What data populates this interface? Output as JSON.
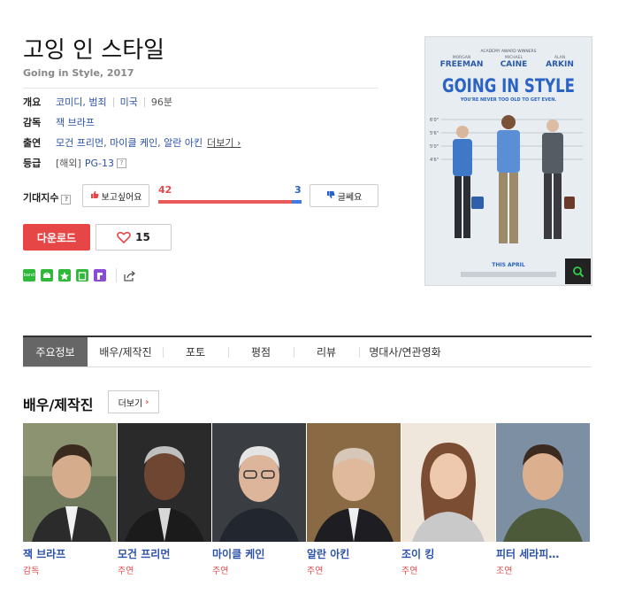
{
  "movie": {
    "title": "고잉 인 스타일",
    "subtitle": "Going in Style, 2017"
  },
  "info": {
    "overview_label": "개요",
    "genre": "코미디, 범죄",
    "country": "미국",
    "runtime": "96분",
    "director_label": "감독",
    "director": "잭 브라프",
    "cast_label": "출연",
    "cast": "모건 프리먼, 마이클 케인, 알란 아킨",
    "cast_more": "더보기 ›",
    "rating_label": "등급",
    "rating_region": "[해외]",
    "rating": "PG-13",
    "help_icon_text": "?"
  },
  "expectation": {
    "label": "기대지수",
    "want_label": "보고싶어요",
    "want_count": "42",
    "meh_label": "글쎄요",
    "meh_count": "3",
    "want_ratio": 0.933
  },
  "actions": {
    "download_label": "다운로드",
    "like_count": "15"
  },
  "share": {
    "icons": [
      "band-icon",
      "kakaostory-icon",
      "bookmark-star-icon",
      "note-icon",
      "flipboard-icon",
      "share-icon"
    ],
    "band_text": "band",
    "colors": {
      "green": "#2fb83a",
      "purple": "#8a4bd6"
    }
  },
  "poster": {
    "award_line": "ACADEMY AWARD WINNERS",
    "actor1_first": "MORGAN",
    "actor1_last": "FREEMAN",
    "actor2_first": "MICHAEL",
    "actor2_last": "CAINE",
    "actor3_first": "ALAN",
    "actor3_last": "ARKIN",
    "title": "GOING IN STYLE",
    "tagline": "YOU'RE NEVER TOO OLD TO GET EVEN.",
    "release": "THIS APRIL",
    "heights": [
      "6'0\"",
      "5'6\"",
      "5'0\"",
      "4'6\""
    ]
  },
  "tabs": [
    {
      "label": "주요정보",
      "active": true
    },
    {
      "label": "배우/제작진",
      "active": false
    },
    {
      "label": "포토",
      "active": false
    },
    {
      "label": "평점",
      "active": false
    },
    {
      "label": "리뷰",
      "active": false
    },
    {
      "label": "명대사/연관영화",
      "active": false
    }
  ],
  "cast_section": {
    "heading": "배우/제작진",
    "more_label": "더보기",
    "more_chevron": "›",
    "people": [
      {
        "name": "잭 브라프",
        "role": "감독"
      },
      {
        "name": "모건 프리먼",
        "role": "주연"
      },
      {
        "name": "마이클 케인",
        "role": "주연"
      },
      {
        "name": "알란 아킨",
        "role": "주연"
      },
      {
        "name": "조이 킹",
        "role": "주연"
      },
      {
        "name": "피터 세라피…",
        "role": "조연"
      }
    ]
  }
}
